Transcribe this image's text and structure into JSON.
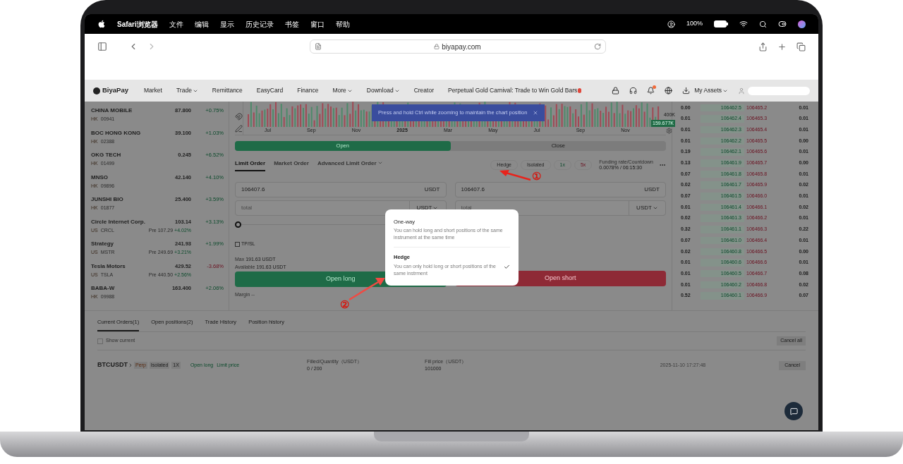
{
  "menubar": {
    "app": "Safari浏览器",
    "menus": [
      "文件",
      "编辑",
      "显示",
      "历史记录",
      "书签",
      "窗口",
      "帮助"
    ],
    "battery": "100%"
  },
  "browser": {
    "url": "biyapay.com"
  },
  "nav": {
    "logo": "BiyaPay",
    "items": [
      {
        "label": "Market",
        "dropdown": false
      },
      {
        "label": "Trade",
        "dropdown": true
      },
      {
        "label": "Remittance",
        "dropdown": false
      },
      {
        "label": "EasyCard",
        "dropdown": false
      },
      {
        "label": "Finance",
        "dropdown": false
      },
      {
        "label": "More",
        "dropdown": true
      },
      {
        "label": "Download",
        "dropdown": true
      },
      {
        "label": "Creator",
        "dropdown": false
      }
    ],
    "promo": "Perpetual Gold Carnival: Trade to Win Gold Bars",
    "assets": "My Assets"
  },
  "stocks": [
    {
      "name": "CHINA MOBILE",
      "market": "HK",
      "code": "00941",
      "price": "87.800",
      "change": "+0.75%",
      "up": true
    },
    {
      "name": "BOC HONG KONG",
      "market": "HK",
      "code": "02388",
      "price": "39.100",
      "change": "+1.03%",
      "up": true
    },
    {
      "name": "OKG TECH",
      "market": "HK",
      "code": "01499",
      "price": "0.245",
      "change": "+6.52%",
      "up": true
    },
    {
      "name": "MNSO",
      "market": "HK",
      "code": "09896",
      "price": "42.140",
      "change": "+4.10%",
      "up": true
    },
    {
      "name": "JUNSHI BIO",
      "market": "HK",
      "code": "01877",
      "price": "25.400",
      "change": "+3.59%",
      "up": true
    },
    {
      "name": "Circle Internet Corp.",
      "market": "US",
      "code": "CRCL",
      "price": "103.14",
      "pre": "Pre 107.29",
      "pre_change": "+4.02%",
      "change": "+3.13%",
      "up": true
    },
    {
      "name": "Strategy",
      "market": "US",
      "code": "MSTR",
      "price": "241.93",
      "pre": "Pre 249.69",
      "pre_change": "+3.21%",
      "change": "+1.99%",
      "up": true
    },
    {
      "name": "Tesla Motors",
      "market": "US",
      "code": "TSLA",
      "price": "429.52",
      "pre": "Pre 440.50",
      "pre_change": "+2.56%",
      "change": "-3.68%",
      "up": false
    },
    {
      "name": "BABA-W",
      "market": "HK",
      "code": "09988",
      "price": "163.400",
      "change": "+2.06%",
      "up": true
    }
  ],
  "chart": {
    "xlabels": [
      "Jul",
      "Sep",
      "Nov",
      "2025",
      "Mar",
      "May",
      "Jul",
      "Sep",
      "Nov"
    ],
    "volume_tick": "400K",
    "volume_value": "159.677K",
    "toast": "Press and hold Ctrl while zooming to maintain the chart position"
  },
  "side_tabs": [
    {
      "label": "Open",
      "selected": true
    },
    {
      "label": "Close",
      "selected": false
    }
  ],
  "order_tabs": [
    {
      "label": "Limit Order",
      "selected": true,
      "dropdown": false
    },
    {
      "label": "Market Order",
      "selected": false,
      "dropdown": false
    },
    {
      "label": "Advanced Limit Order",
      "selected": false,
      "dropdown": true
    }
  ],
  "mode_chips": [
    {
      "label": "Hedge",
      "kind": "neutral"
    },
    {
      "label": "Isolated",
      "kind": "neutral"
    },
    {
      "label": "1x",
      "kind": "long"
    },
    {
      "label": "5x",
      "kind": "short"
    }
  ],
  "funding": {
    "label": "Funding rate/Countdown",
    "value": "0.0078% / 06:15:30"
  },
  "long_form": {
    "price": "106407.6",
    "price_unit": "USDT",
    "total_placeholder": "total",
    "total_unit": "USDT",
    "slider": {
      "level": 0
    },
    "tpsl": {
      "label": "TP/SL",
      "checked": false
    },
    "max_label": "Max",
    "max": "191.63 USDT",
    "available_label": "Available",
    "available": "191.63 USDT",
    "button": "Open long",
    "margin": "Margin --"
  },
  "short_form": {
    "price": "106407.6",
    "price_unit": "USDT",
    "total_placeholder": "total",
    "total_unit": "USDT",
    "button": "Open short"
  },
  "orderbook": [
    [
      "0.00",
      "106462.5",
      "106465.2",
      "0.01"
    ],
    [
      "0.01",
      "106462.4",
      "106465.3",
      "0.01"
    ],
    [
      "0.01",
      "106462.3",
      "106465.4",
      "0.01"
    ],
    [
      "0.01",
      "106462.2",
      "106465.5",
      "0.00"
    ],
    [
      "0.19",
      "106462.1",
      "106465.6",
      "0.01"
    ],
    [
      "0.13",
      "106461.9",
      "106465.7",
      "0.00"
    ],
    [
      "0.07",
      "106461.8",
      "106465.8",
      "0.01"
    ],
    [
      "0.02",
      "106461.7",
      "106465.9",
      "0.02"
    ],
    [
      "0.07",
      "106461.5",
      "106466.0",
      "0.01"
    ],
    [
      "0.01",
      "106461.4",
      "106466.1",
      "0.02"
    ],
    [
      "0.02",
      "106461.3",
      "106466.2",
      "0.01"
    ],
    [
      "0.32",
      "106461.1",
      "106466.3",
      "0.22"
    ],
    [
      "0.07",
      "106461.0",
      "106466.4",
      "0.01"
    ],
    [
      "0.02",
      "106460.8",
      "106466.5",
      "0.00"
    ],
    [
      "0.01",
      "106460.6",
      "106466.6",
      "0.01"
    ],
    [
      "0.01",
      "106460.5",
      "106466.7",
      "0.08"
    ],
    [
      "0.01",
      "106460.2",
      "106466.8",
      "0.02"
    ],
    [
      "0.52",
      "106460.1",
      "106466.9",
      "0.07"
    ]
  ],
  "bottom_tabs": [
    {
      "label": "Current Orders(1)",
      "selected": true
    },
    {
      "label": "Open positions(2)",
      "selected": false
    },
    {
      "label": "Trade History",
      "selected": false
    },
    {
      "label": "Position history",
      "selected": false
    }
  ],
  "show_current": {
    "label": "Show current",
    "checked": false
  },
  "cancel_all": "Cancel all",
  "order": {
    "symbol": "BTCUSDT",
    "tags": [
      "Perp",
      "Isolated",
      "1X"
    ],
    "side": "Open long",
    "type": "Limit price",
    "filled_label": "Filled/Quantity（USDT）",
    "filled": "0 / 200",
    "fill_price_label": "Fill price（USDT）",
    "fill_price": "101000",
    "time": "2025-11-10 17:27:48",
    "cancel": "Cancel"
  },
  "popup": {
    "options": [
      {
        "title": "One-way",
        "description": "You can hold long and short positions of the same instrument at the same time",
        "selected": false
      },
      {
        "title": "Hedge",
        "description": "You can only hold long or short positions of the same instrment",
        "selected": true
      }
    ]
  },
  "annotations": [
    "①",
    "②"
  ]
}
